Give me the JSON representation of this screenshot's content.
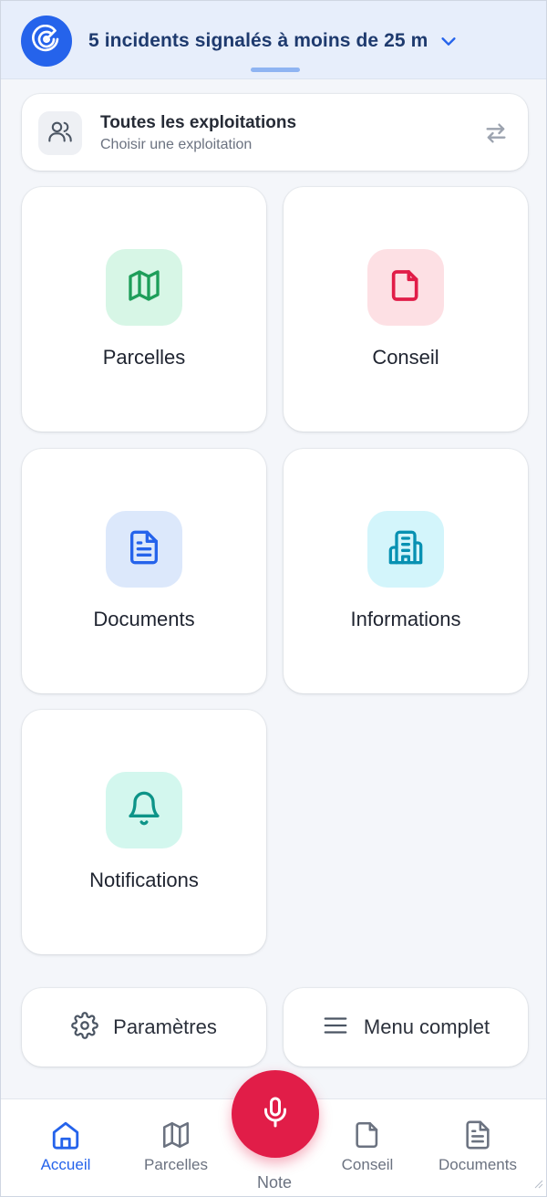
{
  "incident": {
    "text": "5 incidents signalés à moins de 25 m"
  },
  "farm": {
    "title": "Toutes les exploitations",
    "subtitle": "Choisir une exploitation"
  },
  "tiles": [
    {
      "label": "Parcelles",
      "icon": "map-icon",
      "bg": "#d7f6e6",
      "color": "#1e9e5a"
    },
    {
      "label": "Conseil",
      "icon": "document-icon",
      "bg": "#fde0e4",
      "color": "#e11d48"
    },
    {
      "label": "Documents",
      "icon": "file-text-icon",
      "bg": "#dce8fb",
      "color": "#2563eb"
    },
    {
      "label": "Informations",
      "icon": "building-icon",
      "bg": "#d3f5fb",
      "color": "#0891b2"
    },
    {
      "label": "Notifications",
      "icon": "bell-icon",
      "bg": "#d3f7ee",
      "color": "#0d9488"
    }
  ],
  "actions": {
    "settings_label": "Paramètres",
    "menu_label": "Menu complet"
  },
  "nav": {
    "items": [
      {
        "label": "Accueil",
        "icon": "home-icon",
        "active": true
      },
      {
        "label": "Parcelles",
        "icon": "map-icon",
        "active": false
      },
      {
        "label": "Conseil",
        "icon": "document-icon",
        "active": false
      },
      {
        "label": "Documents",
        "icon": "file-text-icon",
        "active": false
      }
    ],
    "mic_label": "Note"
  },
  "colors": {
    "accent": "#2563eb",
    "mic": "#e11d48"
  }
}
